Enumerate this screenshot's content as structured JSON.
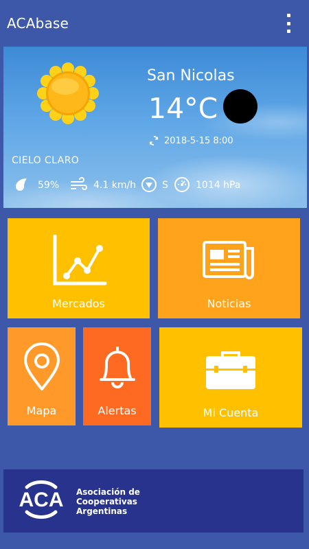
{
  "app": {
    "title": "ACAbase"
  },
  "weather": {
    "city": "San Nicolas",
    "temperature": "14°C",
    "updated": "2018-5-15 8:00",
    "condition": "CIELO CLARO",
    "humidity": "59%",
    "wind": "4.1 km/h",
    "wind_direction": "S",
    "pressure": "1014 hPa"
  },
  "tiles": {
    "mercados": "Mercados",
    "noticias": "Noticias",
    "mapa": "Mapa",
    "alertas": "Alertas",
    "mi_cuenta": "Mi Cuenta"
  },
  "colors": {
    "background": "#3d58a8",
    "tile_yellow": "#ffc000",
    "tile_orange": "#ff9a2a",
    "tile_red_orange": "#ff6a22",
    "tile_amber": "#ffa21c",
    "footer": "#27338c"
  },
  "icons": {
    "menu": "more-vert-icon",
    "weather": "sun-icon",
    "moon": "moon-icon",
    "refresh": "refresh-icon",
    "humidity": "drop-icon",
    "wind": "wind-icon",
    "compass": "compass-icon",
    "pressure": "gauge-icon",
    "mercados": "chart-icon",
    "noticias": "newspaper-icon",
    "mapa": "map-pin-icon",
    "alertas": "bell-icon",
    "mi_cuenta": "briefcase-icon"
  },
  "footer": {
    "logo_text": "ACA",
    "org_line1": "Asociación de",
    "org_line2": "Cooperativas",
    "org_line3": "Argentinas"
  }
}
